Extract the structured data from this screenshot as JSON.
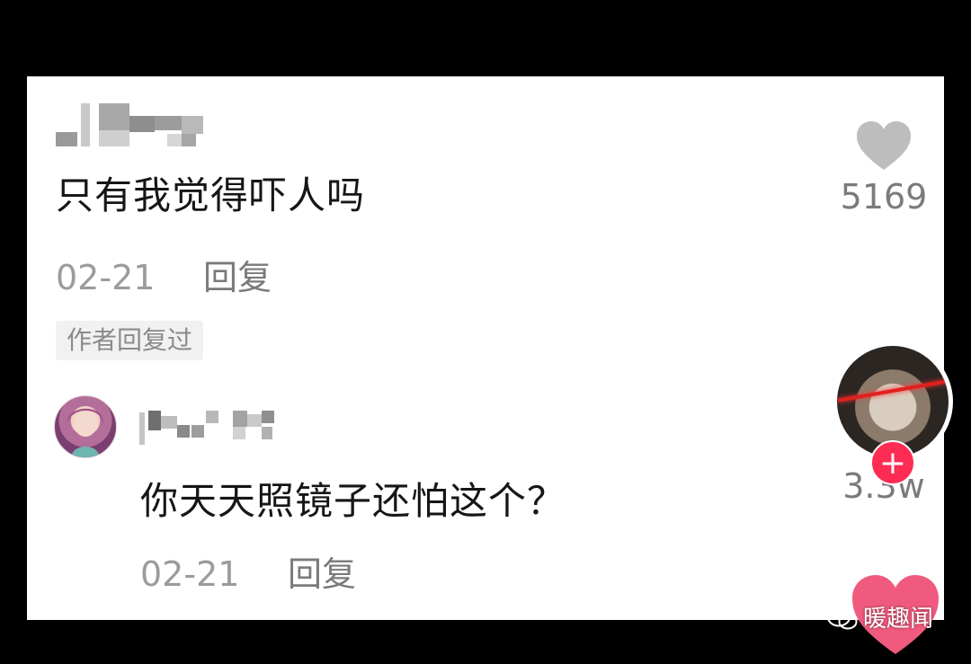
{
  "comments": [
    {
      "text": "只有我觉得吓人吗",
      "date": "02-21",
      "reply_label": "回复",
      "likes": "5169",
      "author_tag": "作者回复过"
    },
    {
      "text": "你天天照镜子还怕这个？",
      "date": "02-21",
      "reply_label": "回复",
      "likes": "3.3w"
    }
  ],
  "watermark": "暖趣闻",
  "follow_label": "+",
  "colors": {
    "accent": "#fe2c55",
    "meta_text": "#9b9b9b",
    "like_icon": "#bdbdbd"
  },
  "icons": [
    "heart-icon",
    "plus-icon",
    "wechat-icon"
  ]
}
